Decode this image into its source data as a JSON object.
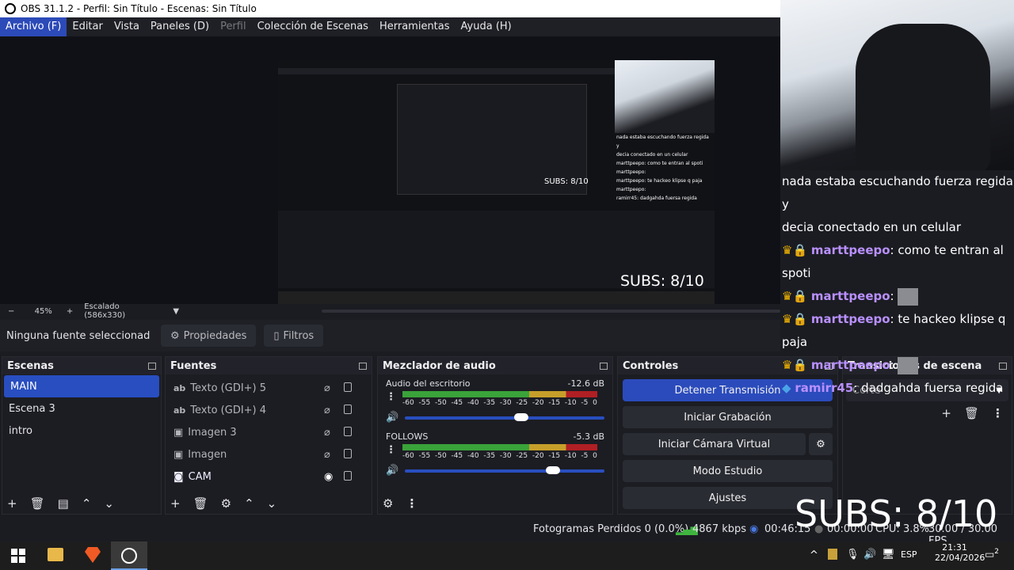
{
  "window": {
    "title": "OBS 31.1.2 - Perfil: Sin Título - Escenas: Sin Título"
  },
  "menu": [
    "Archivo (F)",
    "Editar",
    "Vista",
    "Paneles (D)",
    "Perfil",
    "Colección de Escenas",
    "Herramientas",
    "Ayuda (H)"
  ],
  "preview": {
    "zoom": "45%",
    "scaling": "Escalado (586x330)",
    "subs_overlay": "SUBS: 8/10",
    "inner_chat": [
      "nada estaba escuchando fuerza regida y",
      "decia conectado en un celular",
      "marttpeepo: como te entran al spoti",
      "marttpeepo:",
      "marttpeepo: te hackeo klipse q paja",
      "marttpeepo:",
      "ramirr45: dadgahda fuersa regida"
    ]
  },
  "source_bar": {
    "no_source": "Ninguna fuente seleccionad",
    "properties": "Propiedades",
    "filters": "Filtros"
  },
  "scenes": {
    "title": "Escenas",
    "items": [
      "MAIN",
      "Escena 3",
      "intro"
    ]
  },
  "sources": {
    "title": "Fuentes",
    "items": [
      {
        "name": "Texto (GDI+) 5",
        "type": "text"
      },
      {
        "name": "Texto (GDI+) 4",
        "type": "text"
      },
      {
        "name": "Imagen 3",
        "type": "image"
      },
      {
        "name": "Imagen",
        "type": "image"
      },
      {
        "name": "CAM",
        "type": "camera"
      }
    ]
  },
  "mixer": {
    "title": "Mezclador de audio",
    "channels": [
      {
        "name": "Audio del escritorio",
        "level": "-12.6 dB",
        "volume": 0.58
      },
      {
        "name": "FOLLOWS",
        "level": "-5.3 dB",
        "volume": 0.74
      }
    ],
    "scale": [
      "-60",
      "-55",
      "-50",
      "-45",
      "-40",
      "-35",
      "-30",
      "-25",
      "-20",
      "-15",
      "-10",
      "-5",
      "0"
    ]
  },
  "controls": {
    "title": "Controles",
    "stop_stream": "Detener Transmisión",
    "start_recording": "Iniciar Grabación",
    "start_virtualcam": "Iniciar Cámara Virtual",
    "studio_mode": "Modo Estudio",
    "settings": "Ajustes"
  },
  "transitions": {
    "title": "Transiciones de escena",
    "selected": "Corte"
  },
  "status": {
    "dropped": "Fotogramas Perdidos 0 (0.0%)",
    "bitrate": "4867 kbps",
    "time": "00:46:15",
    "rec_time": "00:00:00",
    "cpu": "CPU: 3.8%",
    "fps": "30.00 / 30.00 FPS"
  },
  "chat": [
    {
      "text": "nada estaba escuchando fuerza regida y"
    },
    {
      "text": "decia conectado en un celular"
    },
    {
      "user": "marttpeepo",
      "msg": ": como te entran al spoti"
    },
    {
      "user": "marttpeepo",
      "msg": ":"
    },
    {
      "user": "marttpeepo",
      "msg": ": te hackeo klipse q paja"
    },
    {
      "user": "marttpeepo",
      "msg": ":"
    },
    {
      "user": "ramirr45",
      "msg": ": dadgahda fuersa regida"
    }
  ],
  "subs_overlay": "SUBS: 8/10",
  "taskbar": {
    "time": "21:31",
    "date": "22/04/2026",
    "lang": "ESP",
    "notifications": "2"
  }
}
